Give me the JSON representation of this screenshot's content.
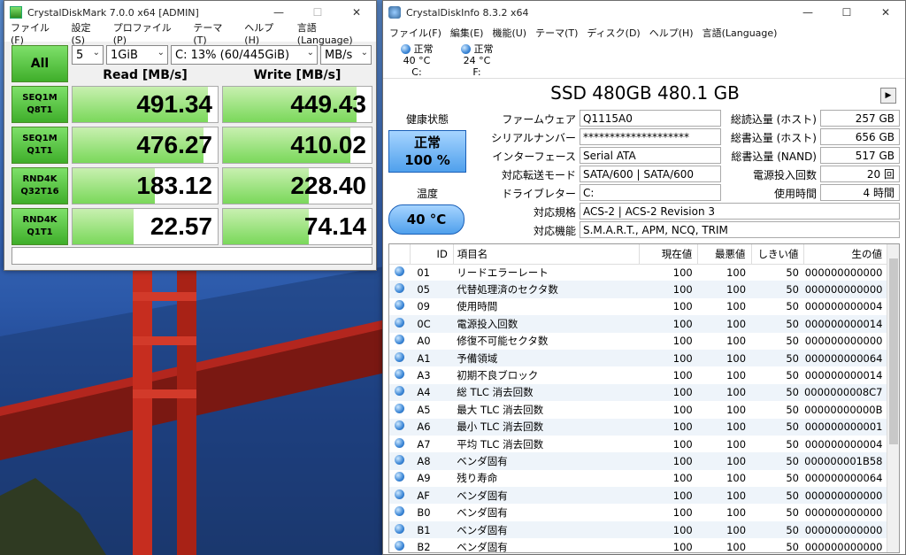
{
  "cdm": {
    "title": "CrystalDiskMark 7.0.0 x64 [ADMIN]",
    "menu": [
      "ファイル(F)",
      "設定(S)",
      "プロファイル(P)",
      "テーマ(T)",
      "ヘルプ(H)",
      "言語(Language)"
    ],
    "all_label": "All",
    "count": "5",
    "size": "1GiB",
    "drive": "C: 13% (60/445GiB)",
    "unit": "MB/s",
    "read_header": "Read [MB/s]",
    "write_header": "Write [MB/s]",
    "rows": [
      {
        "l1": "SEQ1M",
        "l2": "Q8T1",
        "read": "491.34",
        "write": "449.43",
        "read_pct": 0.93,
        "write_pct": 0.9
      },
      {
        "l1": "SEQ1M",
        "l2": "Q1T1",
        "read": "476.27",
        "write": "410.02",
        "read_pct": 0.9,
        "write_pct": 0.86
      },
      {
        "l1": "RND4K",
        "l2": "Q32T16",
        "read": "183.12",
        "write": "228.40",
        "read_pct": 0.57,
        "write_pct": 0.58
      },
      {
        "l1": "RND4K",
        "l2": "Q1T1",
        "read": "22.57",
        "write": "74.14",
        "read_pct": 0.42,
        "write_pct": 0.58
      }
    ]
  },
  "cdi": {
    "title": "CrystalDiskInfo 8.3.2 x64",
    "menu": [
      "ファイル(F)",
      "編集(E)",
      "機能(U)",
      "テーマ(T)",
      "ディスク(D)",
      "ヘルプ(H)",
      "言語(Language)"
    ],
    "drives": [
      {
        "status": "正常",
        "temp": "40 °C",
        "letter": "C:"
      },
      {
        "status": "正常",
        "temp": "24 °C",
        "letter": "F:"
      }
    ],
    "model": "SSD 480GB 480.1 GB",
    "health_label": "健康状態",
    "health_status": "正常",
    "health_pct": "100 %",
    "temp_label": "温度",
    "temp_value": "40 °C",
    "info_left": [
      {
        "k": "ファームウェア",
        "v": "Q1115A0"
      },
      {
        "k": "シリアルナンバー",
        "v": "********************"
      },
      {
        "k": "インターフェース",
        "v": "Serial ATA"
      },
      {
        "k": "対応転送モード",
        "v": "SATA/600 | SATA/600"
      },
      {
        "k": "ドライブレター",
        "v": "C:"
      }
    ],
    "info_right": [
      {
        "k": "総読込量 (ホスト)",
        "v": "257 GB"
      },
      {
        "k": "総書込量 (ホスト)",
        "v": "656 GB"
      },
      {
        "k": "総書込量 (NAND)",
        "v": "517 GB"
      },
      {
        "k": "電源投入回数",
        "v": "20 回"
      },
      {
        "k": "使用時間",
        "v": "4 時間"
      }
    ],
    "standard_label": "対応規格",
    "standard": "ACS-2 | ACS-2 Revision 3",
    "features_label": "対応機能",
    "features": "S.M.A.R.T., APM, NCQ, TRIM",
    "smart_headers": [
      "ID",
      "項目名",
      "現在値",
      "最悪値",
      "しきい値",
      "生の値"
    ],
    "smart": [
      [
        "01",
        "リードエラーレート",
        "100",
        "100",
        "50",
        "000000000000"
      ],
      [
        "05",
        "代替処理済のセクタ数",
        "100",
        "100",
        "50",
        "000000000000"
      ],
      [
        "09",
        "使用時間",
        "100",
        "100",
        "50",
        "000000000004"
      ],
      [
        "0C",
        "電源投入回数",
        "100",
        "100",
        "50",
        "000000000014"
      ],
      [
        "A0",
        "修復不可能セクタ数",
        "100",
        "100",
        "50",
        "000000000000"
      ],
      [
        "A1",
        "予備領域",
        "100",
        "100",
        "50",
        "000000000064"
      ],
      [
        "A3",
        "初期不良ブロック",
        "100",
        "100",
        "50",
        "000000000014"
      ],
      [
        "A4",
        "総 TLC 消去回数",
        "100",
        "100",
        "50",
        "0000000008C7"
      ],
      [
        "A5",
        "最大 TLC 消去回数",
        "100",
        "100",
        "50",
        "00000000000B"
      ],
      [
        "A6",
        "最小 TLC 消去回数",
        "100",
        "100",
        "50",
        "000000000001"
      ],
      [
        "A7",
        "平均 TLC 消去回数",
        "100",
        "100",
        "50",
        "000000000004"
      ],
      [
        "A8",
        "ベンダ固有",
        "100",
        "100",
        "50",
        "000000001B58"
      ],
      [
        "A9",
        "残り寿命",
        "100",
        "100",
        "50",
        "000000000064"
      ],
      [
        "AF",
        "ベンダ固有",
        "100",
        "100",
        "50",
        "000000000000"
      ],
      [
        "B0",
        "ベンダ固有",
        "100",
        "100",
        "50",
        "000000000000"
      ],
      [
        "B1",
        "ベンダ固有",
        "100",
        "100",
        "50",
        "000000000000"
      ],
      [
        "B2",
        "ベンダ固有",
        "100",
        "100",
        "50",
        "000000000000"
      ]
    ]
  }
}
